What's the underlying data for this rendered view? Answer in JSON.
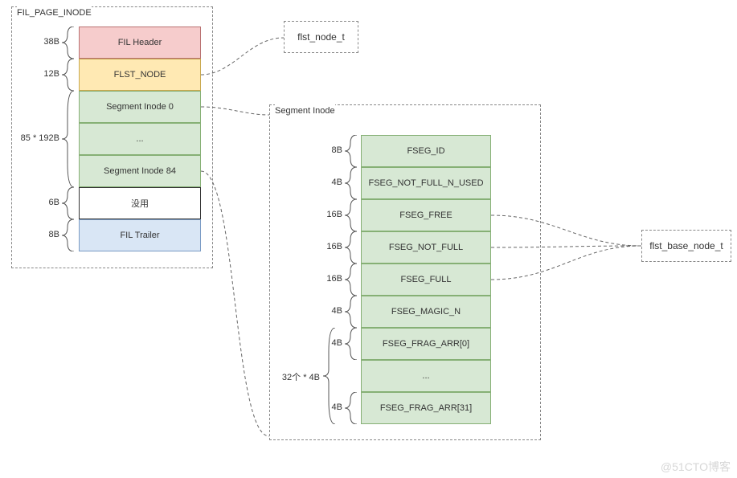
{
  "left_box": {
    "title": "FIL_PAGE_INODE",
    "rows": [
      {
        "size": "38B",
        "label": "FIL Header",
        "cls": "red"
      },
      {
        "size": "12B",
        "label": "FLST_NODE",
        "cls": "yellow"
      },
      {
        "size": "85 * 192B",
        "label": "Segment Inode 0",
        "cls": "green"
      },
      {
        "size": "",
        "label": "...",
        "cls": "green"
      },
      {
        "size": "",
        "label": "Segment Inode 84",
        "cls": "green"
      },
      {
        "size": "6B",
        "label": "没用",
        "cls": "white"
      },
      {
        "size": "8B",
        "label": "FIL Trailer",
        "cls": "blue"
      }
    ]
  },
  "flst_box": {
    "label": "flst_node_t"
  },
  "right_box": {
    "title": "Segment Inode",
    "rows": [
      {
        "size": "8B",
        "label": "FSEG_ID"
      },
      {
        "size": "4B",
        "label": "FSEG_NOT_FULL_N_USED"
      },
      {
        "size": "16B",
        "label": "FSEG_FREE"
      },
      {
        "size": "16B",
        "label": "FSEG_NOT_FULL"
      },
      {
        "size": "16B",
        "label": "FSEG_FULL"
      },
      {
        "size": "4B",
        "label": "FSEG_MAGIC_N"
      },
      {
        "size": "4B",
        "label": "FSEG_FRAG_ARR[0]"
      },
      {
        "size": "",
        "label": "..."
      },
      {
        "size": "4B",
        "label": "FSEG_FRAG_ARR[31]"
      }
    ],
    "outer_size": "32个 * 4B"
  },
  "base_box": {
    "label": "flst_base_node_t"
  },
  "watermark": "@51CTO博客"
}
